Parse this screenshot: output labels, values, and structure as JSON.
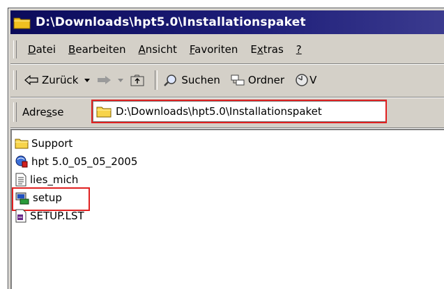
{
  "window": {
    "title": "D:\\Downloads\\hpt5.0\\Installationspaket"
  },
  "menubar": {
    "items": [
      {
        "label": "Datei",
        "accel": "D"
      },
      {
        "label": "Bearbeiten",
        "accel": "B"
      },
      {
        "label": "Ansicht",
        "accel": "A"
      },
      {
        "label": "Favoriten",
        "accel": "F"
      },
      {
        "label": "Extras",
        "accel": "x"
      },
      {
        "label": "?",
        "accel": "?"
      }
    ]
  },
  "toolbar": {
    "back_label": "Zurück",
    "search_label": "Suchen",
    "folders_label": "Ordner",
    "history_partial": "V"
  },
  "addressbar": {
    "label": "Adresse",
    "value": "D:\\Downloads\\hpt5.0\\Installationspaket"
  },
  "files": [
    {
      "name": "Support",
      "icon": "folder-icon"
    },
    {
      "name": "hpt 5.0_05_05_2005",
      "icon": "app-icon"
    },
    {
      "name": "lies_mich",
      "icon": "text-file-icon"
    },
    {
      "name": "setup",
      "icon": "setup-icon",
      "highlighted": true
    },
    {
      "name": "SETUP.LST",
      "icon": "lst-file-icon"
    }
  ],
  "colors": {
    "highlight": "#e02020",
    "titlebar": "#0b0b5a",
    "chrome": "#d4d0c8"
  }
}
